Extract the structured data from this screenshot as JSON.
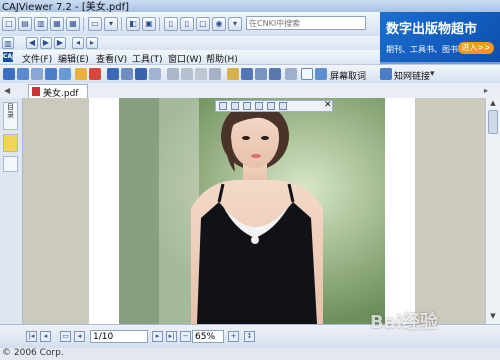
{
  "window": {
    "title": "CAJViewer 7.2 - [美女.pdf]"
  },
  "search": {
    "placeholder": "在CNKI中搜索"
  },
  "ad": {
    "headline": "数字出版物超市",
    "sub": "期刊、工具书、图书......",
    "button": "进入>>"
  },
  "menu": {
    "items": [
      "文件(F)",
      "编辑(E)",
      "查看(V)",
      "工具(T)",
      "窗口(W)",
      "帮助(H)"
    ]
  },
  "toolbar3": {
    "screen_capture": "屏幕取词",
    "find_link": "知网链接"
  },
  "document": {
    "tab_label": "美女.pdf"
  },
  "status": {
    "page_value": "1/10",
    "zoom_value": "65%",
    "copyright": "© 2006 Corp."
  },
  "watermark": "Bai经验"
}
